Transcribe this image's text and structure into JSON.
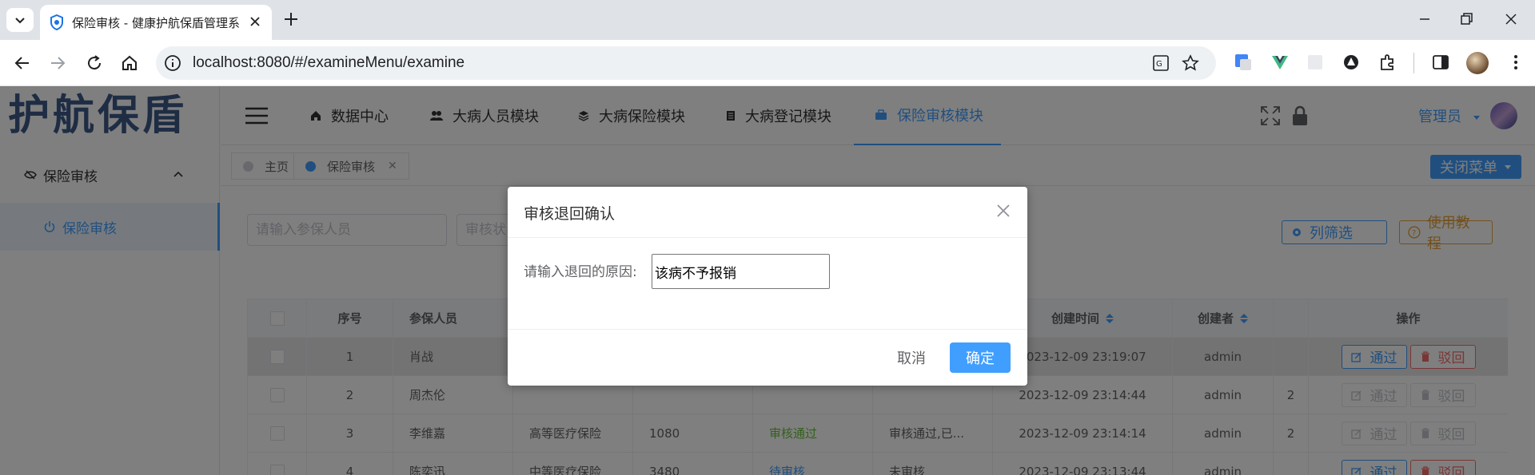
{
  "browser": {
    "tab_title": "保险审核 - 健康护航保盾管理系",
    "url": "localhost:8080/#/examineMenu/examine"
  },
  "app": {
    "logo": "护航保盾",
    "sidebar": {
      "group_label": "保险审核",
      "item_label": "保险审核"
    },
    "topnav": {
      "items": [
        {
          "label": "数据中心",
          "icon": "home-icon"
        },
        {
          "label": "大病人员模块",
          "icon": "users-icon"
        },
        {
          "label": "大病保险模块",
          "icon": "layers-icon"
        },
        {
          "label": "大病登记模块",
          "icon": "document-icon"
        },
        {
          "label": "保险审核模块",
          "icon": "briefcase-icon"
        }
      ],
      "active_index": 4,
      "user": "管理员"
    },
    "tags": {
      "home": "主页",
      "current": "保险审核",
      "close_menu": "关闭菜单"
    },
    "search": {
      "insured_placeholder": "请输入参保人员",
      "status_placeholder": "审核状"
    },
    "toolbar": {
      "column_filter": "列筛选",
      "tutorial": "使用教程"
    },
    "table": {
      "headers": [
        "序号",
        "参保人员",
        "",
        "",
        "",
        "",
        "创建时间",
        "创建者",
        "",
        "操作"
      ],
      "rows": [
        {
          "no": "1",
          "person": "肖战",
          "insurance": "",
          "amount": "",
          "status": "",
          "remark": "",
          "created": "2023-12-09 23:19:07",
          "creator": "admin",
          "extra": "",
          "enabled": true
        },
        {
          "no": "2",
          "person": "周杰伦",
          "insurance": "",
          "amount": "",
          "status": "",
          "remark": "",
          "created": "2023-12-09 23:14:44",
          "creator": "admin",
          "extra": "2",
          "enabled": false
        },
        {
          "no": "3",
          "person": "李维嘉",
          "insurance": "高等医疗保险",
          "amount": "1080",
          "status": "审核通过",
          "remark": "审核通过,已...",
          "created": "2023-12-09 23:14:14",
          "creator": "admin",
          "extra": "2",
          "enabled": false
        },
        {
          "no": "4",
          "person": "陈奕迅",
          "insurance": "中等医疗保险",
          "amount": "3480",
          "status": "待审核",
          "remark": "未审核",
          "created": "2023-12-09 23:13:44",
          "creator": "admin",
          "extra": "",
          "enabled": true
        }
      ],
      "pass_label": "通过",
      "reject_label": "驳回"
    }
  },
  "dialog": {
    "title": "审核退回确认",
    "label": "请输入退回的原因:",
    "input_value": "该病不予报销",
    "cancel": "取消",
    "confirm": "确定"
  },
  "colors": {
    "primary": "#409eff",
    "success": "#67c23a",
    "warning": "#e6a23c",
    "danger": "#f56c6c"
  }
}
